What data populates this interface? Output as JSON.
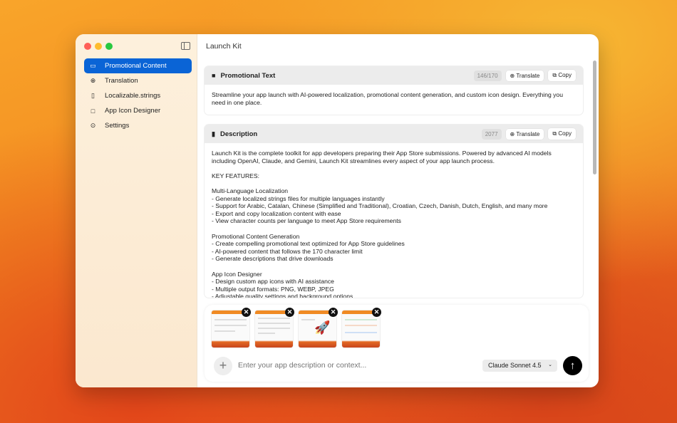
{
  "window": {
    "title": "Launch Kit"
  },
  "sidebar": {
    "items": [
      {
        "label": "Promotional Content",
        "icon": "message-icon",
        "glyph": "▭"
      },
      {
        "label": "Translation",
        "icon": "globe-icon",
        "glyph": "⊕"
      },
      {
        "label": "Localizable.strings",
        "icon": "document-icon",
        "glyph": "▯"
      },
      {
        "label": "App Icon Designer",
        "icon": "app-icon-icon",
        "glyph": "□"
      },
      {
        "label": "Settings",
        "icon": "play-circle-icon",
        "glyph": "⊙"
      }
    ]
  },
  "promo": {
    "title": "Promotional Text",
    "count": "146/170",
    "translate": "Translate",
    "copy": "Copy",
    "text": "Streamline your app launch with AI-powered localization, promotional content generation, and custom icon design. Everything you need in one place."
  },
  "description": {
    "title": "Description",
    "count": "2077",
    "translate": "Translate",
    "copy": "Copy",
    "text": "Launch Kit is the complete toolkit for app developers preparing their App Store submissions. Powered by advanced AI models including OpenAI, Claude, and Gemini, Launch Kit streamlines every aspect of your app launch process.\n\nKEY FEATURES:\n\nMulti-Language Localization\n- Generate localized strings files for multiple languages instantly\n- Support for Arabic, Catalan, Chinese (Simplified and Traditional), Croatian, Czech, Danish, Dutch, English, and many more\n- Export and copy localization content with ease\n- View character counts per language to meet App Store requirements\n\nPromotional Content Generation\n- Create compelling promotional text optimized for App Store guidelines\n- AI-powered content that follows the 170 character limit\n- Generate descriptions that drive downloads\n\nApp Icon Designer\n- Design custom app icons with AI assistance\n- Multiple output formats: PNG, WEBP, JPEG\n- Adjustable quality settings and background options"
  },
  "composer": {
    "placeholder": "Enter your app description or context...",
    "model": "Claude Sonnet 4.5",
    "attachments": 4
  }
}
